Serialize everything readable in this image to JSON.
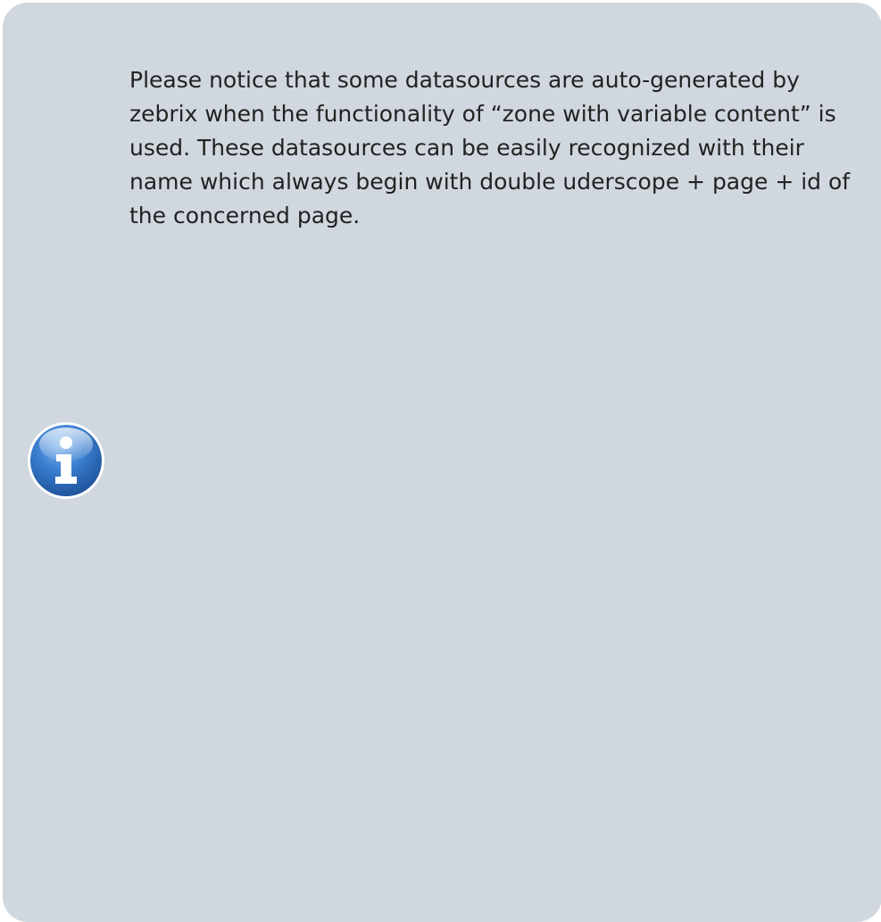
{
  "note": {
    "type": "info",
    "icon": "info-icon",
    "background_color": "#d0d7df",
    "icon_color": "#2a6fc2",
    "text": "Please notice that some datasources are auto-generated by zebrix when the functionality of “zone with variable content” is used. These datasources can be easily recognized with their name which always begin with double uderscope + page + id of the concerned page."
  }
}
